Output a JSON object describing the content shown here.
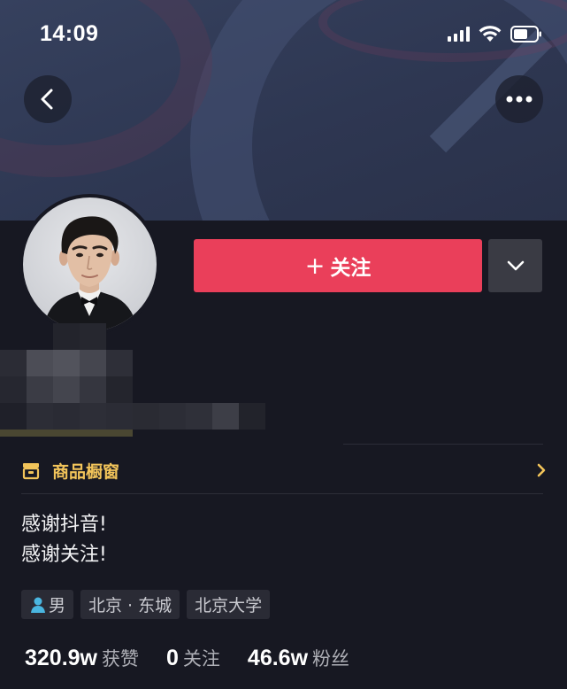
{
  "status_bar": {
    "time": "14:09"
  },
  "header": {
    "back_icon": "chevron-left-icon",
    "more_icon": "more-horizontal-icon"
  },
  "profile": {
    "follow_label": "关注",
    "follow_plus": "+",
    "shop_label": "商品橱窗",
    "bio_lines": [
      "感谢抖音!",
      "感谢关注!"
    ],
    "tags": {
      "gender": "男",
      "location": "北京 · 东城",
      "school": "北京大学"
    },
    "stats": [
      {
        "value": "320.9w",
        "label": "获赞"
      },
      {
        "value": "0",
        "label": "关注"
      },
      {
        "value": "46.6w",
        "label": "粉丝"
      }
    ]
  },
  "colors": {
    "background": "#171822",
    "follow_button": "#ea3f5a",
    "shop_accent": "#f2c45a",
    "gender_icon": "#4ab6e0"
  }
}
